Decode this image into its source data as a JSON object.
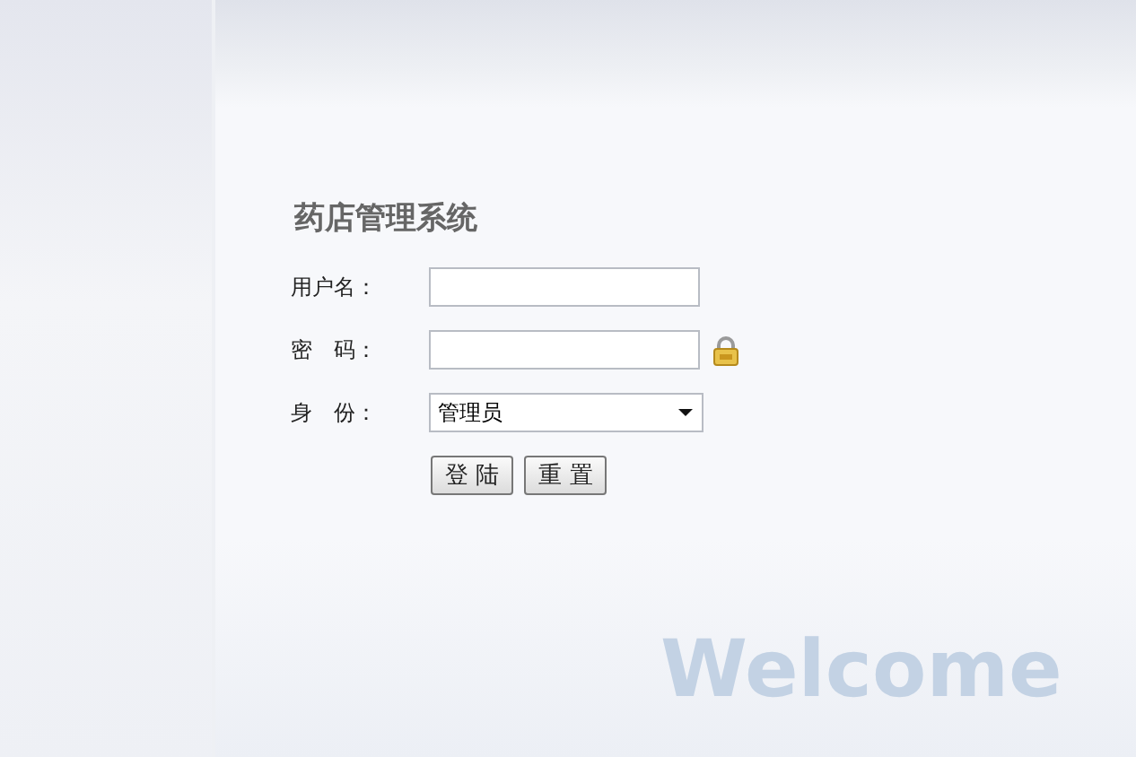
{
  "title": "药店管理系统",
  "fields": [
    {
      "kind": "text",
      "label": "用户名："
    },
    {
      "kind": "password",
      "label": "密　码："
    },
    {
      "kind": "select",
      "label": "身　份：",
      "value": "管理员"
    }
  ],
  "buttons": [
    "登 陆",
    "重 置"
  ],
  "welcome": "Welcome"
}
